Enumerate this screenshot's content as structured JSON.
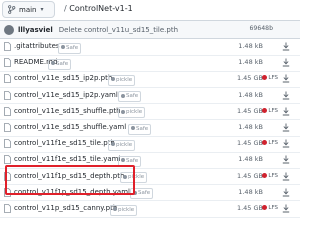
{
  "header": {
    "branch": "main",
    "repo": "ControlNet-v1-1",
    "separator": "/"
  },
  "commit": {
    "author": "lllyasviel",
    "message": "Delete control_v11u_sd15_tile.pth",
    "sha": "69648b"
  },
  "files": [
    {
      "name": ".gitattributes",
      "tag": "Safe",
      "size": "1.48 kB",
      "lfs": false
    },
    {
      "name": "README.md",
      "tag": "Safe",
      "size": "1.48 kB",
      "lfs": false
    },
    {
      "name": "control_v11e_sd15_ip2p.pth",
      "tag": "pickle",
      "size": "1.45 GB",
      "lfs": true
    },
    {
      "name": "control_v11e_sd15_ip2p.yaml",
      "tag": "Safe",
      "size": "1.48 kB",
      "lfs": false
    },
    {
      "name": "control_v11e_sd15_shuffle.pth",
      "tag": "pickle",
      "size": "1.45 GB",
      "lfs": true
    },
    {
      "name": "control_v11e_sd15_shuffle.yaml",
      "tag": "Safe",
      "size": "1.48 kB",
      "lfs": false
    },
    {
      "name": "control_v11f1e_sd15_tile.pth",
      "tag": "pickle",
      "size": "1.45 GB",
      "lfs": true
    },
    {
      "name": "control_v11f1e_sd15_tile.yaml",
      "tag": "Safe",
      "size": "1.48 kB",
      "lfs": false
    },
    {
      "name": "control_v11f1p_sd15_depth.pth",
      "tag": "pickle",
      "size": "1.45 GB",
      "lfs": true
    },
    {
      "name": "control_v11f1p_sd15_depth.yaml",
      "tag": "Safe",
      "size": "1.48 kB",
      "lfs": false
    },
    {
      "name": "control_v11p_sd15_canny.pth",
      "tag": "pickle",
      "size": "1.45 GB",
      "lfs": true
    }
  ],
  "lfs_label": "LFS",
  "colors": {
    "highlight": "#e0202a",
    "lfs_dot": "#cf222e"
  }
}
